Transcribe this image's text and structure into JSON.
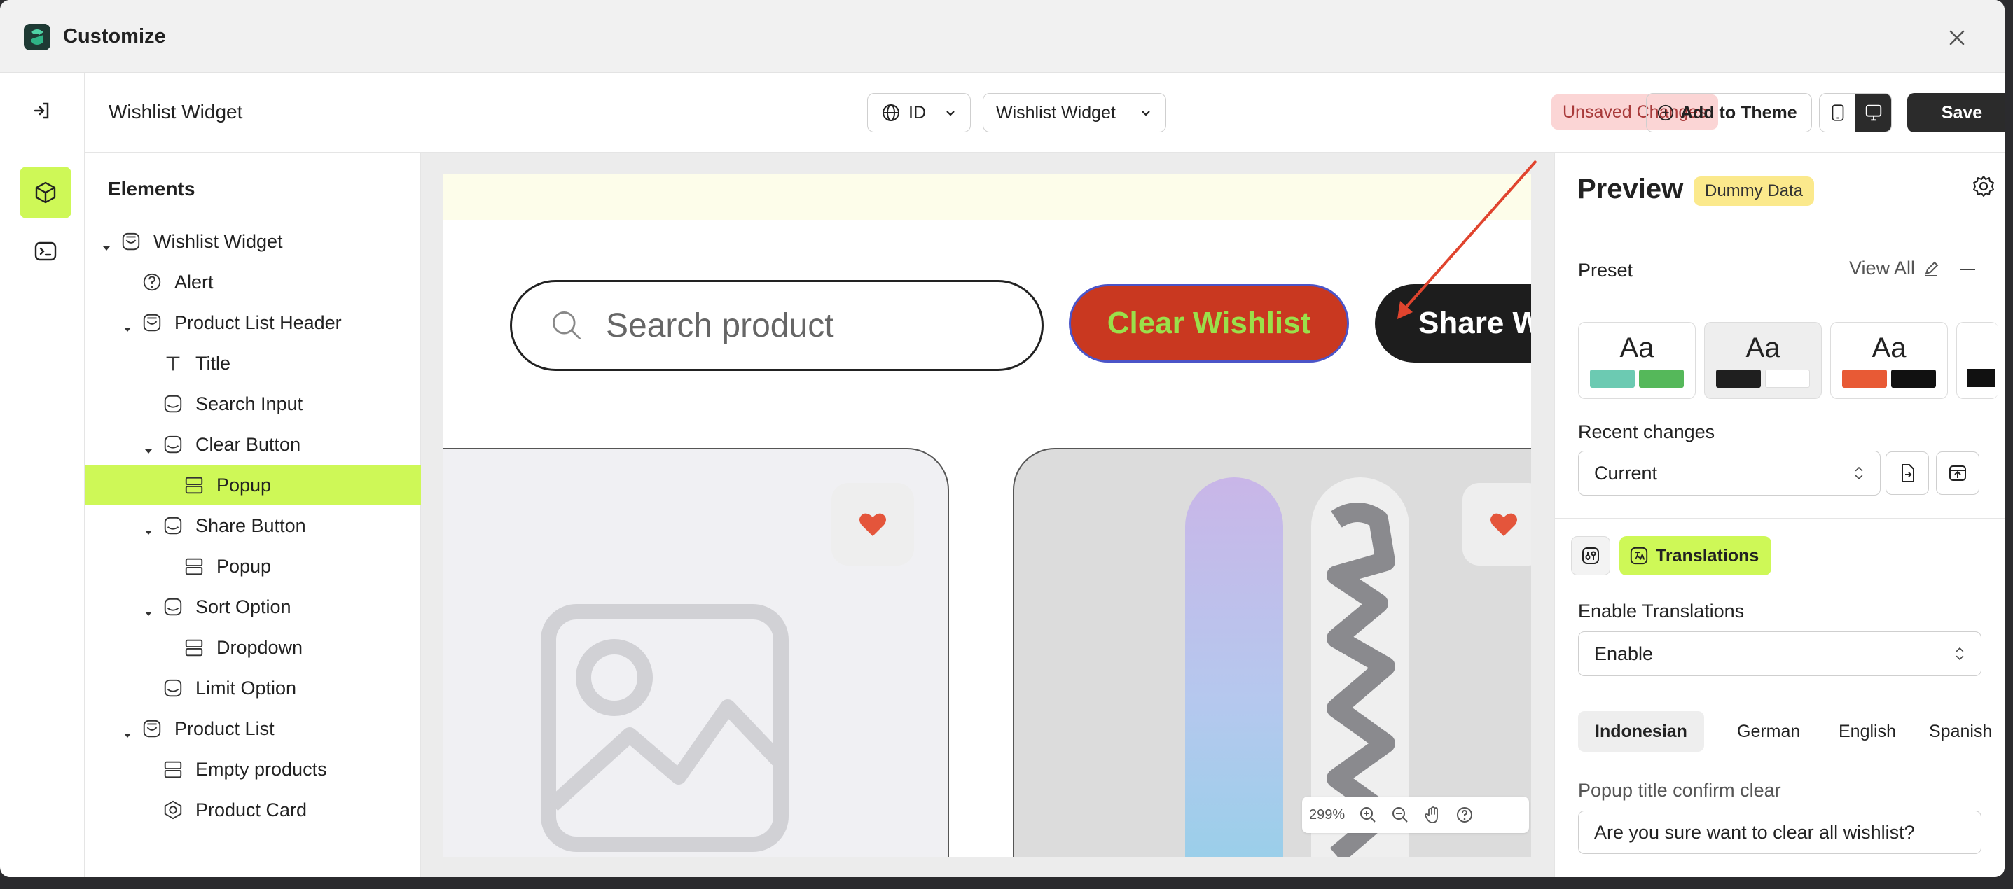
{
  "window": {
    "title": "Customize"
  },
  "topbar": {
    "title": "Wishlist Widget",
    "language_select": "ID",
    "widget_select": "Wishlist Widget",
    "unsaved": "Unsaved Changes",
    "add_to_theme": "Add to Theme",
    "save": "Save"
  },
  "elements": {
    "heading": "Elements",
    "tree": [
      {
        "label": "Wishlist Widget",
        "depth": 0,
        "caret": true,
        "icon": "widget-icon"
      },
      {
        "label": "Alert",
        "depth": 1,
        "caret": false,
        "icon": "help-circle-icon"
      },
      {
        "label": "Product List Header",
        "depth": 1,
        "caret": true,
        "icon": "widget-icon"
      },
      {
        "label": "Title",
        "depth": 2,
        "caret": false,
        "icon": "text-icon"
      },
      {
        "label": "Search Input",
        "depth": 2,
        "caret": false,
        "icon": "component-icon"
      },
      {
        "label": "Clear Button",
        "depth": 2,
        "caret": true,
        "icon": "component-icon"
      },
      {
        "label": "Popup",
        "depth": 3,
        "caret": false,
        "icon": "rows-icon",
        "selected": true
      },
      {
        "label": "Share Button",
        "depth": 2,
        "caret": true,
        "icon": "component-icon"
      },
      {
        "label": "Popup",
        "depth": 3,
        "caret": false,
        "icon": "rows-icon"
      },
      {
        "label": "Sort Option",
        "depth": 2,
        "caret": true,
        "icon": "component-icon"
      },
      {
        "label": "Dropdown",
        "depth": 3,
        "caret": false,
        "icon": "rows-icon"
      },
      {
        "label": "Limit Option",
        "depth": 2,
        "caret": false,
        "icon": "component-icon"
      },
      {
        "label": "Product List",
        "depth": 1,
        "caret": true,
        "icon": "widget-icon"
      },
      {
        "label": "Empty products",
        "depth": 2,
        "caret": false,
        "icon": "rows-icon"
      },
      {
        "label": "Product Card",
        "depth": 2,
        "caret": false,
        "icon": "card-icon"
      }
    ]
  },
  "canvas": {
    "search_placeholder": "Search product",
    "clear_button": "Clear Wishlist",
    "share_button": "Share W",
    "zoom": "299%"
  },
  "preview": {
    "title": "Preview",
    "badge": "Dummy Data",
    "preset_label": "Preset",
    "view_all": "View All",
    "presets": [
      {
        "label": "Aa",
        "colors": [
          "#6ccab2",
          "#55b85a"
        ]
      },
      {
        "label": "Aa",
        "colors": [
          "#1f1f1f",
          "#ffffff"
        ]
      },
      {
        "label": "Aa",
        "colors": [
          "#e85a35",
          "#111111"
        ]
      }
    ],
    "recent_changes_label": "Recent changes",
    "recent_changes_value": "Current",
    "translations_tab": "Translations",
    "enable_translations_label": "Enable Translations",
    "enable_translations_value": "Enable",
    "languages": [
      "Indonesian",
      "German",
      "English",
      "Spanish"
    ],
    "popup_title_label": "Popup title confirm clear",
    "popup_title_value": "Are you sure want to clear all wishlist?"
  },
  "colors": {
    "accent": "#cef857",
    "clear_bg": "#c93820",
    "clear_text": "#9ae04a"
  }
}
